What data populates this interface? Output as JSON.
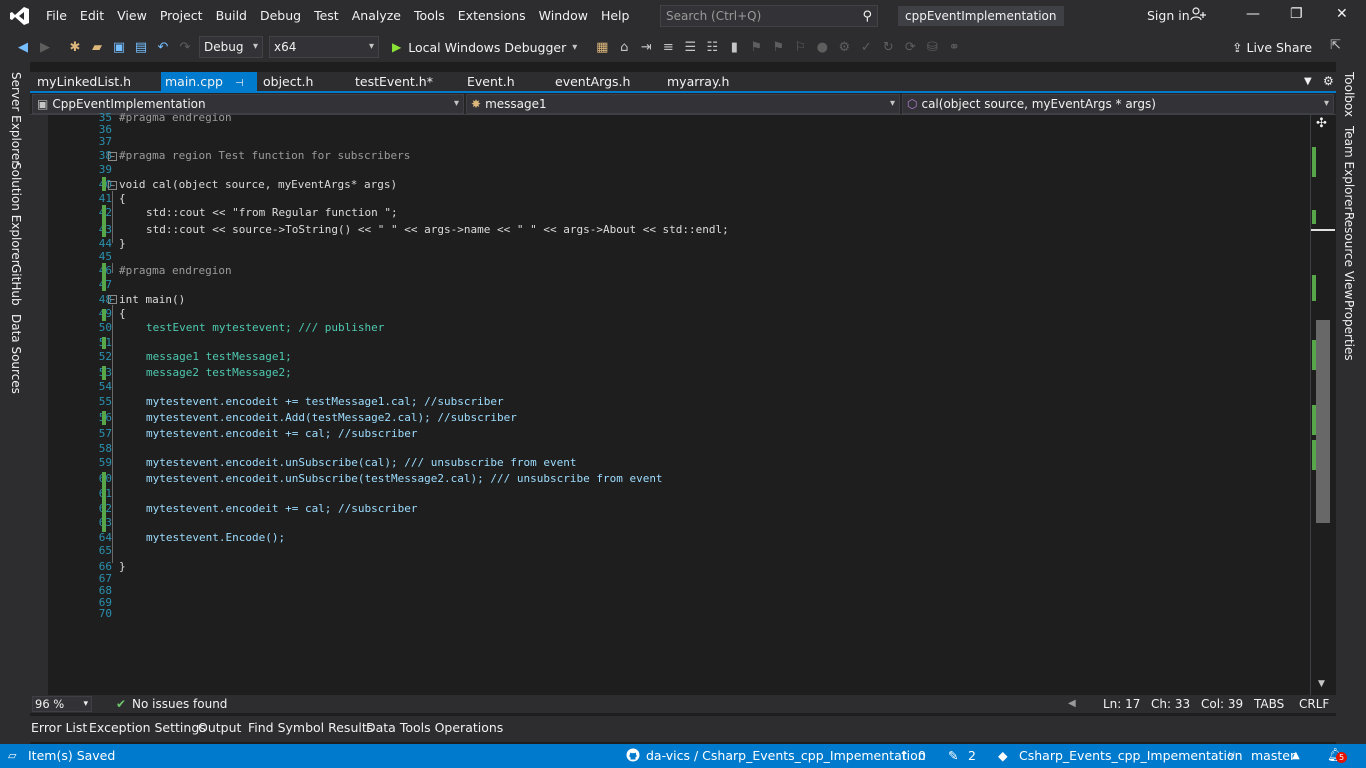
{
  "title_bar": {
    "menu": [
      "File",
      "Edit",
      "View",
      "Project",
      "Build",
      "Debug",
      "Test",
      "Analyze",
      "Tools",
      "Extensions",
      "Window",
      "Help"
    ],
    "search_placeholder": "Search (Ctrl+Q)",
    "project_name": "cppEventImplementation",
    "sign_in": "Sign in"
  },
  "toolbar": {
    "config": "Debug",
    "platform": "x64",
    "run_label": "Local Windows Debugger",
    "live_share": "Live Share"
  },
  "left_rail": [
    "Server Explorer",
    "Solution Explorer",
    "GitHub",
    "Data Sources"
  ],
  "right_rail": [
    "Toolbox",
    "Team Explorer",
    "Resource View",
    "Properties"
  ],
  "tabs": [
    "myLinkedList.h",
    "main.cpp",
    "object.h",
    "testEvent.h*",
    "Event.h",
    "eventArgs.h",
    "myarray.h"
  ],
  "nav": {
    "scope": "CppEventImplementation",
    "type": "message1",
    "member": "cal(object source, myEventArgs * args)"
  },
  "line_numbers": [
    "35",
    "36",
    "37",
    "38",
    "39",
    "40",
    "41",
    "42",
    "43",
    "44",
    "45",
    "46",
    "47",
    "48",
    "49",
    "50",
    "51",
    "52",
    "53",
    "54",
    "55",
    "56",
    "57",
    "58",
    "59",
    "60",
    "61",
    "62",
    "63",
    "64",
    "65",
    "66",
    "67",
    "68",
    "69",
    "70"
  ],
  "code_lines": {
    "l35": "#pragma endregion",
    "l38": "#pragma region Test function for subscribers",
    "l40": "void cal(object source, myEventArgs* args)",
    "l41": "{",
    "l42": "std::cout << \"from Regular function \";",
    "l43": "std::cout << source->ToString() << \" \" << args->name << \" \" << args->About << std::endl;",
    "l44": "}",
    "l46": "#pragma endregion",
    "l48": "int main()",
    "l49": "{",
    "l50": "testEvent mytestevent; /// publisher",
    "l52": "message1 testMessage1;",
    "l53": "message2 testMessage2;",
    "l55": "mytestevent.encodeit += testMessage1.cal; //subscriber",
    "l56": "mytestevent.encodeit.Add(testMessage2.cal); //subscriber",
    "l57": "mytestevent.encodeit += cal; //subscriber",
    "l59": "mytestevent.encodeit.unSubscribe(cal); /// unsubscribe from event",
    "l60": "mytestevent.encodeit.unSubscribe(testMessage2.cal); /// unsubscribe from event",
    "l62": "mytestevent.encodeit += cal; //subscriber",
    "l64": "mytestevent.Encode();",
    "l66": "}"
  },
  "status_line": {
    "zoom": "96 %",
    "issues": "No issues found",
    "ln": "Ln: 17",
    "ch": "Ch: 33",
    "col": "Col: 39",
    "tabs": "TABS",
    "eol": "CRLF"
  },
  "panel_tabs": [
    "Error List",
    "Exception Settings",
    "Output",
    "Find Symbol Results",
    "Data Tools Operations"
  ],
  "status_bar": {
    "message": "Item(s) Saved",
    "repo": "da-vics / Csharp_Events_cpp_Impementation",
    "push_count": "0",
    "changes_count": "2",
    "repo_name": "Csharp_Events_cpp_Impementation",
    "branch": "master",
    "notifications": "5"
  },
  "colors": {
    "accent": "#007acc",
    "chrome": "#2d2d30",
    "editor_bg": "#1e1e1e",
    "change_marker": "#57a64a"
  }
}
